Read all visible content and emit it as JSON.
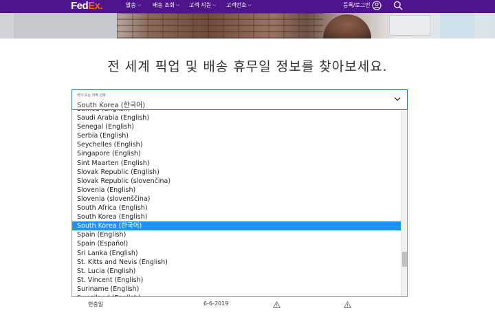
{
  "header": {
    "logo": {
      "fed": "Fed",
      "ex": "Ex."
    },
    "nav": [
      {
        "label": "발송"
      },
      {
        "label": "배송 조회"
      },
      {
        "label": "고객 지원"
      },
      {
        "label": "고객번호"
      }
    ],
    "login_label": "등록/로그인"
  },
  "main": {
    "heading": "전 세계 픽업 및 배송 휴무일 정보를 찾아보세요."
  },
  "select": {
    "label": "국가 또는 지역 선택",
    "value": "South Korea (한국어)"
  },
  "dropdown": {
    "options": [
      {
        "label": "Samoa (English)"
      },
      {
        "label": "Saudi Arabia (English)"
      },
      {
        "label": "Senegal (English)"
      },
      {
        "label": "Serbia (English)"
      },
      {
        "label": "Seychelles (English)"
      },
      {
        "label": "Singapore (English)"
      },
      {
        "label": "Sint Maarten (English)"
      },
      {
        "label": "Slovak Republic (English)"
      },
      {
        "label": "Slovak Republic (slovenčina)"
      },
      {
        "label": "Slovenia (English)"
      },
      {
        "label": "Slovenia (slovenščina)"
      },
      {
        "label": "South Africa (English)"
      },
      {
        "label": "South Korea (English)"
      },
      {
        "label": "South Korea (한국어)",
        "selected": true
      },
      {
        "label": "Spain (English)"
      },
      {
        "label": "Spain (Español)"
      },
      {
        "label": "Sri Lanka (English)"
      },
      {
        "label": "St. Kitts and Nevis (English)"
      },
      {
        "label": "St. Lucia (English)"
      },
      {
        "label": "St. Vincent (English)"
      },
      {
        "label": "Suriname (English)"
      },
      {
        "label": "Swaziland (English)"
      }
    ]
  },
  "table": {
    "row": {
      "name": "현충일",
      "date": "6-6-2019"
    }
  },
  "colors": {
    "brand_purple": "#4d148c",
    "brand_orange": "#ff6200",
    "selection_blue": "#1e90ff",
    "focus_border": "#2f6fcf"
  }
}
